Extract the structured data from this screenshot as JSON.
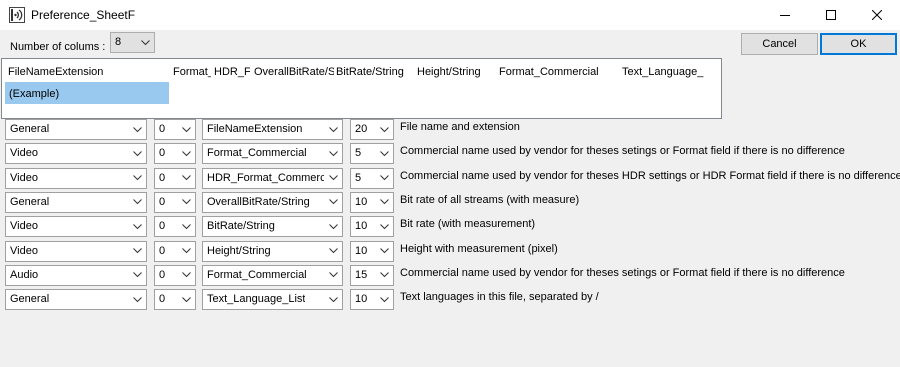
{
  "window": {
    "title": "Preference_SheetF"
  },
  "columns_control": {
    "label": "Number of colums :",
    "value": "8"
  },
  "buttons": {
    "cancel": "Cancel",
    "ok": "OK"
  },
  "preview": {
    "headers": [
      "FileNameExtension",
      "Format_",
      "HDR_Fo",
      "OverallBitRate/S",
      "BitRate/String",
      "Height/String",
      "Format_Commercial",
      "Text_Language_"
    ],
    "row": "(Example)"
  },
  "rows": [
    {
      "stream": "General",
      "index": "0",
      "field": "FileNameExtension",
      "width": "20",
      "description": "File name and extension"
    },
    {
      "stream": "Video",
      "index": "0",
      "field": "Format_Commercial",
      "width": "5",
      "description": "Commercial name used by vendor for theses setings or Format field if there is no difference"
    },
    {
      "stream": "Video",
      "index": "0",
      "field": "HDR_Format_Commercial",
      "width": "5",
      "description": "Commercial name used by vendor for theses HDR settings or HDR Format field if there is no difference"
    },
    {
      "stream": "General",
      "index": "0",
      "field": "OverallBitRate/String",
      "width": "10",
      "description": "Bit rate of all streams (with measure)"
    },
    {
      "stream": "Video",
      "index": "0",
      "field": "BitRate/String",
      "width": "10",
      "description": "Bit rate (with measurement)"
    },
    {
      "stream": "Video",
      "index": "0",
      "field": "Height/String",
      "width": "10",
      "description": "Height with measurement (pixel)"
    },
    {
      "stream": "Audio",
      "index": "0",
      "field": "Format_Commercial",
      "width": "15",
      "description": "Commercial name used by vendor for theses setings or Format field if there is no difference"
    },
    {
      "stream": "General",
      "index": "0",
      "field": "Text_Language_List",
      "width": "10",
      "description": "Text languages in this file, separated by /"
    }
  ]
}
